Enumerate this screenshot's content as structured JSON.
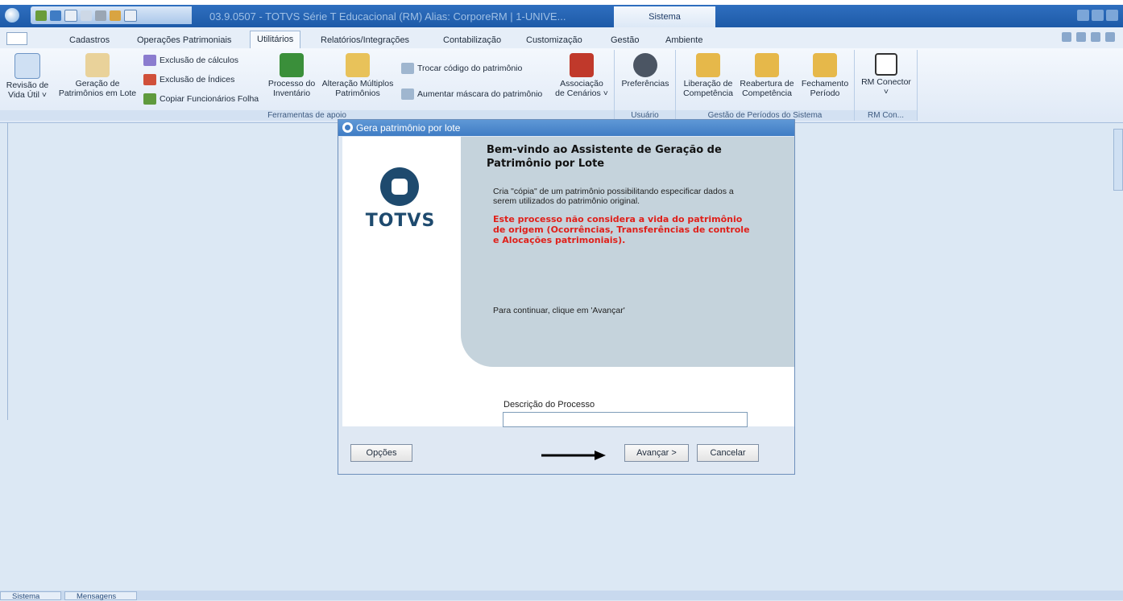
{
  "window": {
    "title": "03.9.0507 - TOTVS Série T Educacional (RM) Alias: CorporeRM | 1-UNIVE...",
    "context_tab": "Sistema"
  },
  "tabs": [
    {
      "label": "Cadastros"
    },
    {
      "label": "Operações Patrimoniais"
    },
    {
      "label": "Utilitários",
      "active": true
    },
    {
      "label": "Relatórios/Integrações"
    },
    {
      "label": "Contabilização"
    },
    {
      "label": "Customização"
    },
    {
      "label": "Gestão"
    },
    {
      "label": "Ambiente"
    }
  ],
  "ribbon": {
    "revisao": {
      "line1": "Revisão de",
      "line2": "Vida Útil ˅"
    },
    "geracao": {
      "line1": "Geração de",
      "line2": "Patrimônios em Lote"
    },
    "exclusao_calculos": "Exclusão de cálculos",
    "exclusao_indices": "Exclusão de Índices",
    "copiar_funcionarios": "Copiar Funcionários Folha",
    "processo_inventario": {
      "line1": "Processo do",
      "line2": "Inventário"
    },
    "alteracao_multiplos": {
      "line1": "Alteração Múltiplos",
      "line2": "Patrimônios"
    },
    "trocar_codigo": "Trocar código do patrimônio",
    "aumentar_mascara": "Aumentar máscara do patrimônio",
    "associacao": {
      "line1": "Associação",
      "line2": "de Cenários ˅"
    },
    "preferencias": "Preferências",
    "liberacao": {
      "line1": "Liberação de",
      "line2": "Competência"
    },
    "reabertura": {
      "line1": "Reabertura de",
      "line2": "Competência"
    },
    "fechamento": {
      "line1": "Fechamento",
      "line2": "Período"
    },
    "rm_conector": {
      "line1": "RM Conector",
      "line2": "˅"
    },
    "group_ferramentas": "Ferramentas de apoio",
    "group_usuario": "Usuário",
    "group_gestao": "Gestão de Períodos do Sistema",
    "group_rmcon": "RM Con..."
  },
  "dialog": {
    "title": "Gera patrimônio por lote",
    "heading": "Bem-vindo ao Assistente de Geração de Patrimônio por Lote",
    "description": "Cria \"cópia\" de um patrimônio possibilitando especificar dados a serem utilizados do patrimônio original.",
    "warning": "Este processo não considera a vida do patrimônio de origem (Ocorrências, Transferências de controle e Alocações patrimoniais).",
    "continue_text": "Para continuar, clique em 'Avançar'",
    "logo_text": "TOTVS",
    "field_label": "Descrição do Processo",
    "field_value": "",
    "options_button": "Opções",
    "next_button": "Avançar >",
    "cancel_button": "Cancelar"
  },
  "statusbar": {
    "sistema": "Sistema",
    "mensagens": "Mensagens"
  },
  "colors": {
    "title_bar": "#1d5aa8",
    "warning_text": "#e0201a",
    "dialog_panel": "#c5d3dc",
    "logo": "#1e4a6e"
  }
}
